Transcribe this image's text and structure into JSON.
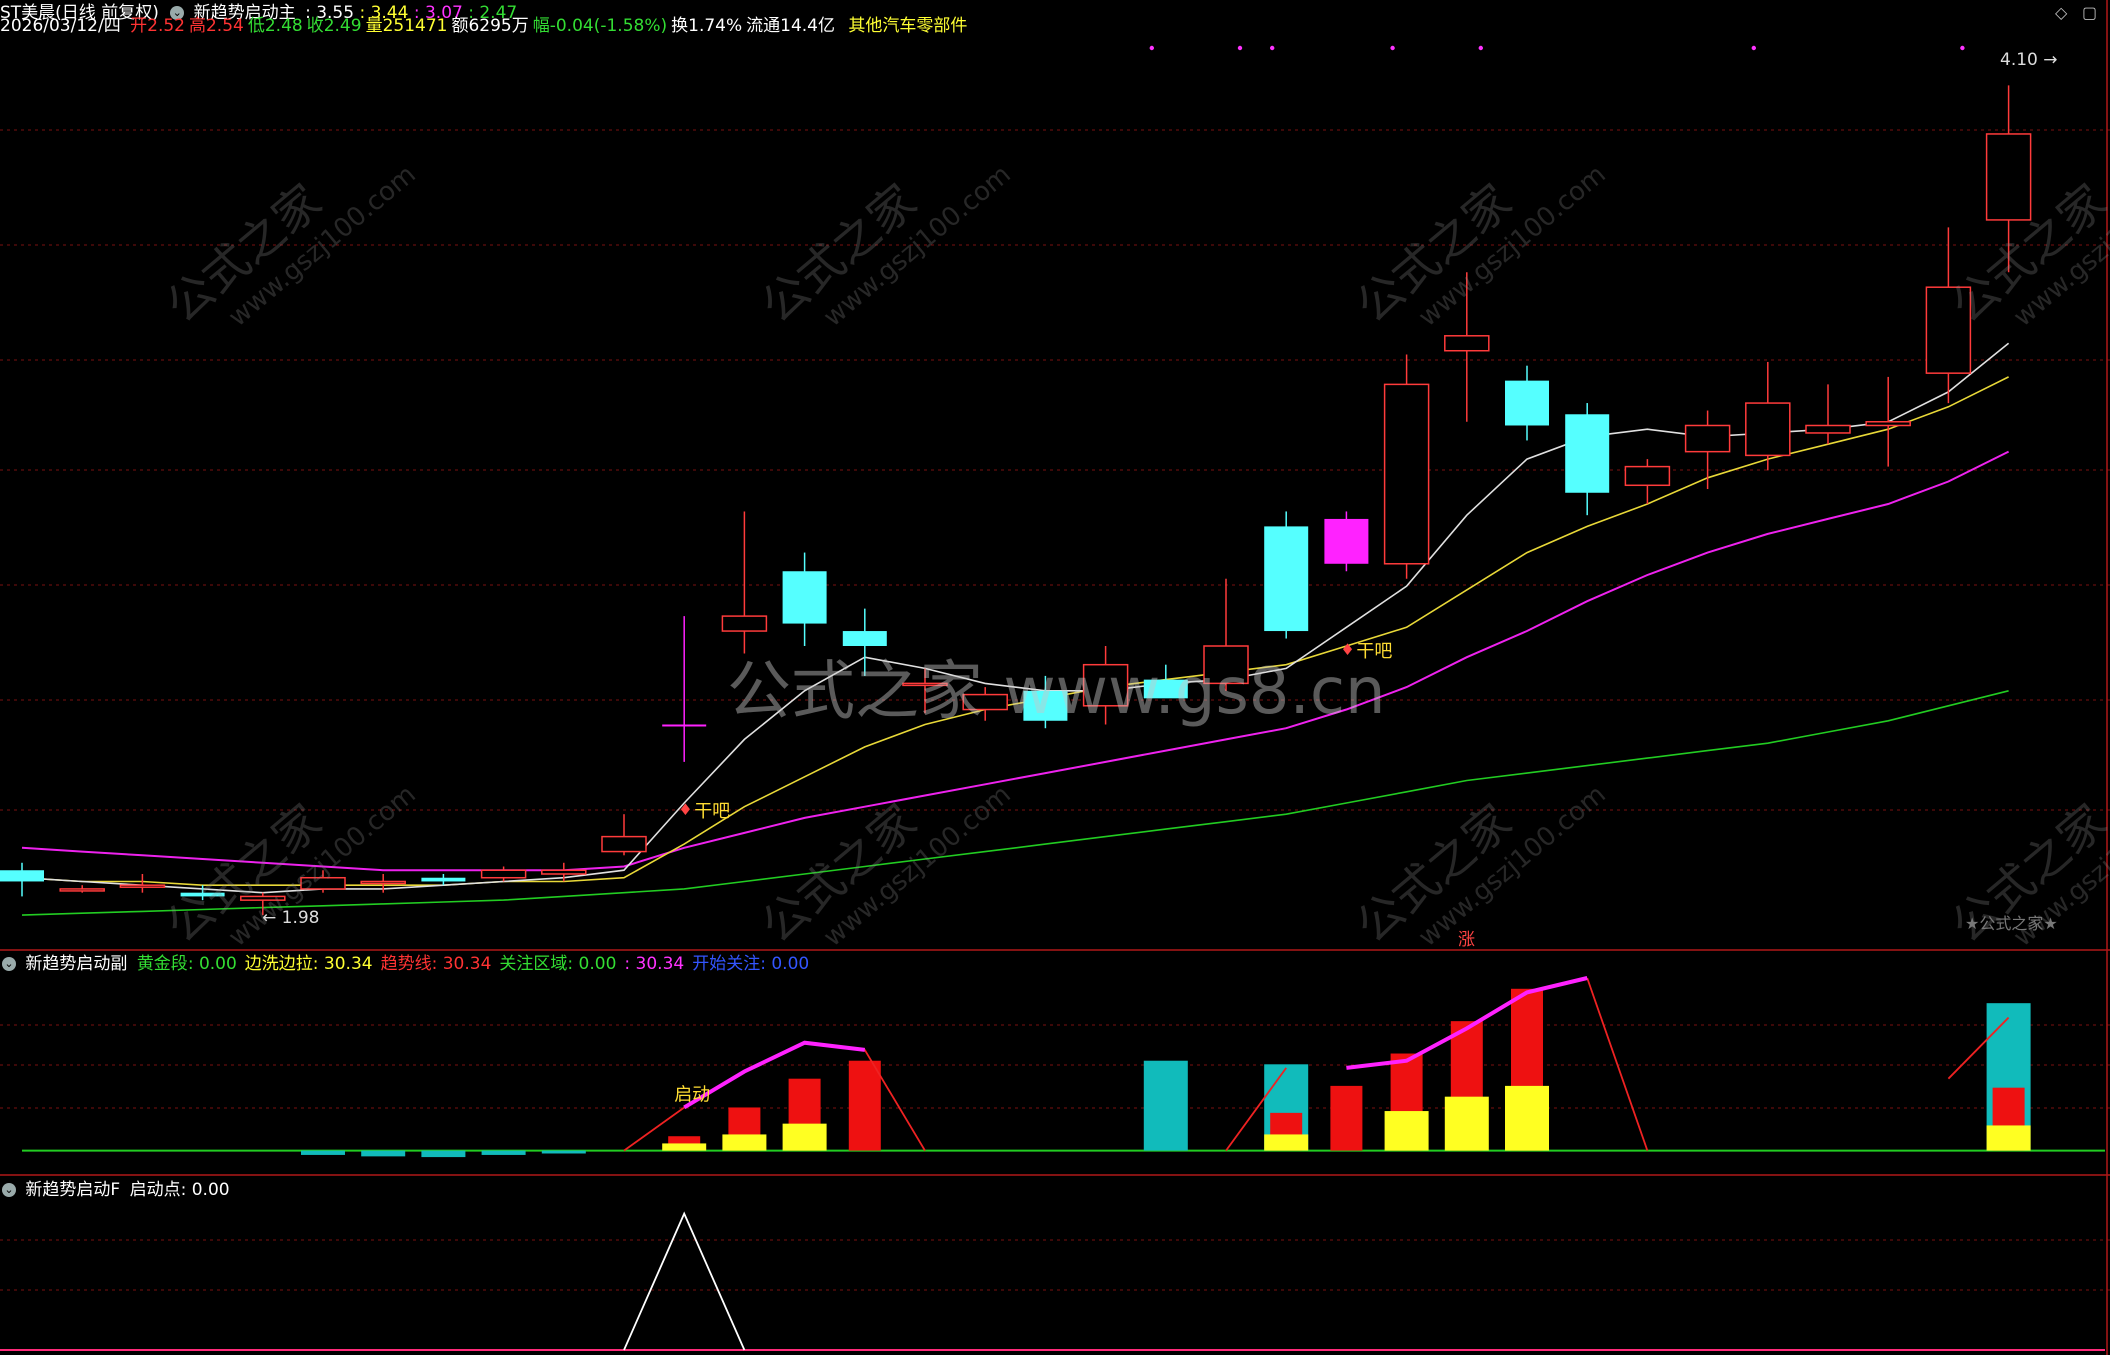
{
  "header": {
    "stock_name": "ST美晨(日线 前复权)",
    "indicator_name": "新趋势启动主",
    "ind_values": [
      {
        "text": ": 3.55",
        "color": "#ffffff"
      },
      {
        "text": ": 3.44",
        "color": "#ffff33"
      },
      {
        "text": ": 3.07",
        "color": "#ff33ff"
      },
      {
        "text": ": 2.47",
        "color": "#33dd33"
      }
    ],
    "date": "2026/03/12/四",
    "fields": [
      {
        "label": "开",
        "value": "2.52",
        "color": "#ff3333"
      },
      {
        "label": "高",
        "value": "2.54",
        "color": "#ff3333"
      },
      {
        "label": "低",
        "value": "2.48",
        "color": "#33dd33"
      },
      {
        "label": "收",
        "value": "2.49",
        "color": "#33dd33"
      },
      {
        "label": "量",
        "value": "251471",
        "color": "#ffff33"
      },
      {
        "label": "额",
        "value": "6295万",
        "color": "#ffffff"
      },
      {
        "label": "幅",
        "value": "-0.04(-1.58%)",
        "color": "#33dd33"
      },
      {
        "label": "换",
        "value": "1.74%",
        "color": "#ffffff"
      },
      {
        "label": "流通",
        "value": "14.4亿",
        "color": "#ffffff"
      }
    ],
    "sector": "其他汽车零部件"
  },
  "main_chart": {
    "price_range": [
      1.9,
      4.3
    ],
    "high_label": "4.10",
    "low_label": "1.98",
    "signal_label": "干吧",
    "zhang_label": "涨",
    "candles": [
      {
        "o": 2.1,
        "h": 2.12,
        "l": 2.03,
        "c": 2.07
      },
      {
        "o": 2.05,
        "h": 2.06,
        "l": 2.04,
        "c": 2.05
      },
      {
        "o": 2.06,
        "h": 2.09,
        "l": 2.04,
        "c": 2.06
      },
      {
        "o": 2.04,
        "h": 2.06,
        "l": 2.02,
        "c": 2.03
      },
      {
        "o": 2.02,
        "h": 2.04,
        "l": 1.98,
        "c": 2.03
      },
      {
        "o": 2.05,
        "h": 2.1,
        "l": 2.04,
        "c": 2.08
      },
      {
        "o": 2.07,
        "h": 2.09,
        "l": 2.04,
        "c": 2.07
      },
      {
        "o": 2.08,
        "h": 2.09,
        "l": 2.06,
        "c": 2.07
      },
      {
        "o": 2.08,
        "h": 2.11,
        "l": 2.07,
        "c": 2.1
      },
      {
        "o": 2.09,
        "h": 2.12,
        "l": 2.07,
        "c": 2.1
      },
      {
        "o": 2.15,
        "h": 2.25,
        "l": 2.14,
        "c": 2.19
      },
      {
        "o": 2.49,
        "h": 2.78,
        "l": 2.39,
        "c": 2.49
      },
      {
        "o": 2.74,
        "h": 3.06,
        "l": 2.68,
        "c": 2.78
      },
      {
        "o": 2.9,
        "h": 2.95,
        "l": 2.7,
        "c": 2.76
      },
      {
        "o": 2.74,
        "h": 2.8,
        "l": 2.62,
        "c": 2.7
      },
      {
        "o": 2.6,
        "h": 2.64,
        "l": 2.52,
        "c": 2.6
      },
      {
        "o": 2.53,
        "h": 2.59,
        "l": 2.5,
        "c": 2.57
      },
      {
        "o": 2.58,
        "h": 2.62,
        "l": 2.48,
        "c": 2.5
      },
      {
        "o": 2.54,
        "h": 2.7,
        "l": 2.49,
        "c": 2.65
      },
      {
        "o": 2.61,
        "h": 2.65,
        "l": 2.57,
        "c": 2.56
      },
      {
        "o": 2.6,
        "h": 2.88,
        "l": 2.58,
        "c": 2.7
      },
      {
        "o": 3.02,
        "h": 3.06,
        "l": 2.72,
        "c": 2.74
      },
      {
        "o": 3.04,
        "h": 3.06,
        "l": 2.9,
        "c": 2.92
      },
      {
        "o": 2.92,
        "h": 3.48,
        "l": 2.88,
        "c": 3.4
      },
      {
        "o": 3.49,
        "h": 3.7,
        "l": 3.3,
        "c": 3.53
      },
      {
        "o": 3.41,
        "h": 3.45,
        "l": 3.25,
        "c": 3.29
      },
      {
        "o": 3.32,
        "h": 3.35,
        "l": 3.05,
        "c": 3.11
      },
      {
        "o": 3.13,
        "h": 3.2,
        "l": 3.08,
        "c": 3.18
      },
      {
        "o": 3.22,
        "h": 3.33,
        "l": 3.12,
        "c": 3.29
      },
      {
        "o": 3.21,
        "h": 3.46,
        "l": 3.17,
        "c": 3.35
      },
      {
        "o": 3.27,
        "h": 3.4,
        "l": 3.24,
        "c": 3.29
      },
      {
        "o": 3.29,
        "h": 3.42,
        "l": 3.18,
        "c": 3.3
      },
      {
        "o": 3.43,
        "h": 3.82,
        "l": 3.35,
        "c": 3.66
      },
      {
        "o": 3.84,
        "h": 4.2,
        "l": 3.7,
        "c": 4.07
      }
    ],
    "ma_white": [
      2.08,
      2.07,
      2.06,
      2.05,
      2.04,
      2.05,
      2.05,
      2.06,
      2.07,
      2.08,
      2.1,
      2.28,
      2.45,
      2.58,
      2.67,
      2.64,
      2.6,
      2.58,
      2.58,
      2.6,
      2.61,
      2.64,
      2.75,
      2.86,
      3.05,
      3.2,
      3.26,
      3.28,
      3.26,
      3.27,
      3.28,
      3.3,
      3.38,
      3.51
    ],
    "ma_yellow": [
      2.08,
      2.07,
      2.07,
      2.06,
      2.06,
      2.06,
      2.06,
      2.06,
      2.07,
      2.07,
      2.08,
      2.17,
      2.27,
      2.35,
      2.43,
      2.49,
      2.53,
      2.56,
      2.59,
      2.61,
      2.63,
      2.65,
      2.7,
      2.75,
      2.85,
      2.95,
      3.02,
      3.08,
      3.15,
      3.2,
      3.24,
      3.28,
      3.34,
      3.42
    ],
    "ma_magenta": [
      2.16,
      2.15,
      2.14,
      2.13,
      2.12,
      2.11,
      2.1,
      2.1,
      2.1,
      2.1,
      2.11,
      2.16,
      2.2,
      2.24,
      2.27,
      2.3,
      2.33,
      2.36,
      2.39,
      2.42,
      2.45,
      2.48,
      2.53,
      2.59,
      2.67,
      2.74,
      2.82,
      2.89,
      2.95,
      3.0,
      3.04,
      3.08,
      3.14,
      3.22
    ],
    "ma_green": [
      1.98,
      1.985,
      1.99,
      1.995,
      2.0,
      2.005,
      2.01,
      2.015,
      2.02,
      2.03,
      2.04,
      2.05,
      2.07,
      2.09,
      2.11,
      2.13,
      2.15,
      2.17,
      2.19,
      2.21,
      2.23,
      2.25,
      2.28,
      2.31,
      2.34,
      2.36,
      2.38,
      2.4,
      2.42,
      2.44,
      2.47,
      2.5,
      2.54,
      2.58
    ],
    "top_dots": [
      19,
      20,
      21,
      23,
      24,
      29,
      32
    ]
  },
  "sub_chart1": {
    "title": "新趋势启动副",
    "items": [
      {
        "label": "黄金段",
        "value": ": 0.00",
        "color": "#33dd33"
      },
      {
        "label": "边洗边拉",
        "value": ": 30.34",
        "color": "#ffff33"
      },
      {
        "label": "趋势线",
        "value": ": 30.34",
        "color": "#ff3333"
      },
      {
        "label": "关注区域",
        "value": ": 0.00",
        "color": "#33dd33"
      },
      {
        "label": "",
        "value": ": 30.34",
        "color": "#ff33ff"
      },
      {
        "label": "开始关注",
        "value": ": 0.00",
        "color": "#3355ff"
      }
    ],
    "start_label": "启动",
    "value_range": [
      -4,
      48
    ],
    "cyan_bars": [
      0,
      0,
      0,
      0,
      0,
      -1.2,
      -1.6,
      -1.8,
      -1.2,
      -0.8,
      0,
      0,
      0,
      0,
      0,
      0,
      0,
      0,
      0,
      25.0,
      0,
      24.0,
      0,
      0,
      0,
      0,
      0,
      0,
      0,
      0,
      0,
      0,
      0,
      41.0
    ],
    "red_bars": [
      0,
      0,
      0,
      0,
      0,
      0,
      0,
      0,
      0,
      0,
      0,
      4.0,
      12.0,
      20.0,
      25.0,
      0,
      0,
      0,
      0,
      0,
      0,
      10.5,
      18.0,
      27.0,
      36.0,
      45.0,
      0,
      0,
      0,
      0,
      0,
      0,
      0,
      17.5
    ],
    "yellow_bars": [
      0,
      0,
      0,
      0,
      0,
      0,
      0,
      0,
      0,
      0,
      0,
      2.0,
      4.5,
      7.5,
      0,
      0,
      0,
      0,
      0,
      0,
      0,
      4.5,
      0,
      11.0,
      15.0,
      18.0,
      0,
      0,
      0,
      0,
      0,
      0,
      0,
      7.0
    ],
    "magenta_line": [
      null,
      null,
      null,
      null,
      null,
      null,
      null,
      null,
      null,
      null,
      null,
      12,
      22,
      30,
      28,
      null,
      null,
      null,
      null,
      null,
      null,
      null,
      23,
      25,
      34,
      44,
      48,
      null,
      null,
      null,
      null,
      null,
      null,
      37
    ],
    "red_line": [
      null,
      null,
      null,
      null,
      null,
      null,
      null,
      null,
      null,
      null,
      0,
      12,
      22,
      30,
      28,
      0,
      null,
      null,
      null,
      null,
      0,
      23,
      null,
      null,
      null,
      null,
      48,
      0,
      null,
      null,
      null,
      null,
      20,
      37
    ]
  },
  "sub_chart2": {
    "title": "新趋势启动F",
    "items": [
      {
        "label": "启动点",
        "value": ": 0.00",
        "color": "#ffffff"
      }
    ],
    "value_range": [
      0,
      1.1
    ],
    "values": [
      0,
      0,
      0,
      0,
      0,
      0,
      0,
      0,
      0,
      0,
      0,
      1,
      0,
      0,
      0,
      0,
      0,
      0,
      0,
      0,
      0,
      0,
      0,
      0,
      0,
      0,
      0,
      0,
      0,
      0,
      0,
      0,
      0,
      0
    ]
  },
  "watermarks": {
    "cn": "公式之家",
    "url": "www.gszj100.com",
    "center": "公式之家 www.gs8.cn",
    "corner": "★公式之家★"
  },
  "colors": {
    "up": "#ff3b3b",
    "down_cyan": "#55ffff",
    "magenta_block": "#ff22ff",
    "grid": "#7a1010"
  }
}
